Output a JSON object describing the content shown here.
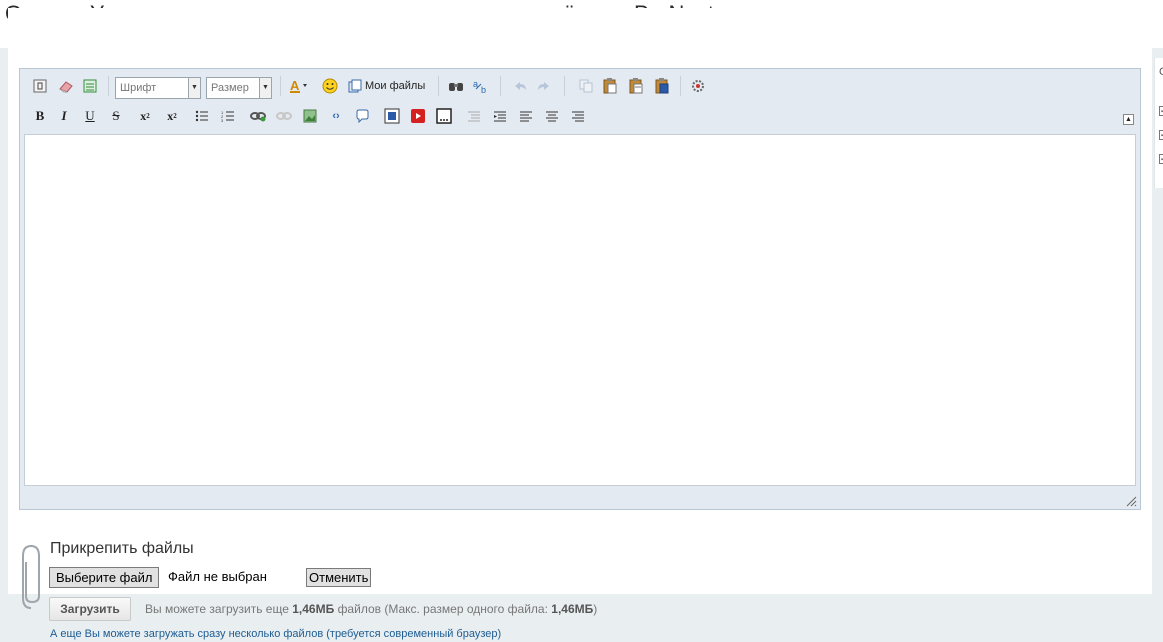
{
  "page": {
    "title": "Ответ в Уроки для самостоятельного составления отчётов в ProNest"
  },
  "toolbar": {
    "font_select": "Шрифт",
    "size_select": "Размер",
    "my_files": "Мои файлы",
    "row1_icons": [
      "source-icon",
      "eraser-icon",
      "template-icon",
      "font-color-icon",
      "smiley-icon",
      "my-files-icon",
      "find-icon",
      "spellcheck-icon",
      "undo-icon",
      "redo-icon",
      "copy-icon",
      "paste-icon",
      "paste-text-icon",
      "paste-word-icon",
      "settings-icon"
    ],
    "row2_icons": [
      "bold-icon",
      "italic-icon",
      "underline-icon",
      "strikethrough-icon",
      "subscript-icon",
      "superscript-icon",
      "unordered-list-icon",
      "ordered-list-icon",
      "link-icon",
      "unlink-icon",
      "image-icon",
      "code-icon",
      "quote-icon",
      "video-icon",
      "youtube-icon",
      "spoiler-icon",
      "align-left-icon",
      "outdent-icon",
      "align-center-icon",
      "align-right-icon"
    ]
  },
  "attach": {
    "title": "Прикрепить файлы",
    "choose_button": "Выберите файл",
    "no_file": "Файл не выбран",
    "cancel_button": "Отменить",
    "upload_button": "Загрузить",
    "note_prefix": "Вы можете загрузить еще",
    "note_size": "1,46МБ",
    "note_middle": "файлов (Макс. размер одного файла:",
    "note_max": "1,46МБ",
    "note_suffix": ")",
    "multi_link": "А еще Вы можете загружать сразу несколько файлов (требуется современный браузер)"
  },
  "side": {
    "letter": "С"
  },
  "colors": {
    "accent_link": "#1d5d93",
    "toolbar_bg": "#e4eaf1",
    "border": "#b9c6d3"
  }
}
